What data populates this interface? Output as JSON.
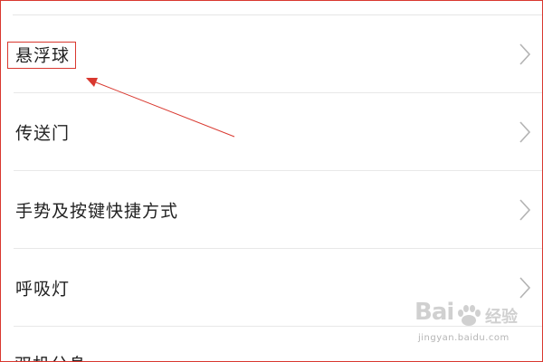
{
  "settings_list": {
    "items": [
      {
        "label": "悬浮球"
      },
      {
        "label": "传送门"
      },
      {
        "label": "手势及按键快捷方式"
      },
      {
        "label": "呼吸灯"
      }
    ],
    "partial_item_label": "双机分身"
  },
  "annotation": {
    "color": "#d9382f",
    "highlighted_item": "悬浮球"
  },
  "watermark": {
    "brand": "Bai",
    "cn": "经验",
    "url": "jingyan.baidu.com"
  },
  "icons": {
    "row_chevron": "chevron-right-icon",
    "watermark_logo": "baidu-paw-icon"
  }
}
